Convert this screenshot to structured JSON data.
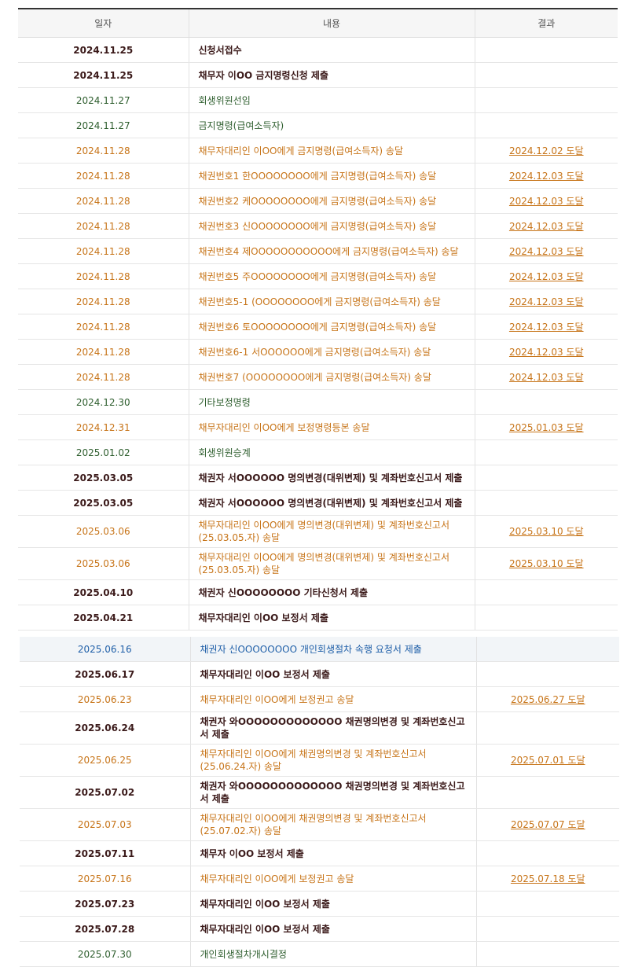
{
  "header": {
    "date": "일자",
    "content": "내용",
    "result": "결과"
  },
  "rows": [
    {
      "date": "2024.11.25",
      "content": "신청서접수",
      "result": "",
      "style": "dark"
    },
    {
      "date": "2024.11.25",
      "content": "채무자 이OO 금지명령신청 제출",
      "result": "",
      "style": "dark"
    },
    {
      "date": "2024.11.27",
      "content": "회생위원선임",
      "result": "",
      "style": "green"
    },
    {
      "date": "2024.11.27",
      "content": "금지명령(급여소득자)",
      "result": "",
      "style": "green"
    },
    {
      "date": "2024.11.28",
      "content": "채무자대리인 이OO에게 금지명령(급여소득자) 송달",
      "result": "2024.12.02 도달",
      "style": "orange"
    },
    {
      "date": "2024.11.28",
      "content": "채권번호1 한OOOOOOOO에게 금지명령(급여소득자) 송달",
      "result": "2024.12.03 도달",
      "style": "orange"
    },
    {
      "date": "2024.11.28",
      "content": "채권번호2 케OOOOOOOO에게 금지명령(급여소득자) 송달",
      "result": "2024.12.03 도달",
      "style": "orange"
    },
    {
      "date": "2024.11.28",
      "content": "채권번호3 신OOOOOOOO에게 금지명령(급여소득자) 송달",
      "result": "2024.12.03 도달",
      "style": "orange"
    },
    {
      "date": "2024.11.28",
      "content": "채권번호4 제OOOOOOOOOOO에게 금지명령(급여소득자) 송달",
      "result": "2024.12.03 도달",
      "style": "orange"
    },
    {
      "date": "2024.11.28",
      "content": "채권번호5 주OOOOOOOO에게 금지명령(급여소득자) 송달",
      "result": "2024.12.03 도달",
      "style": "orange"
    },
    {
      "date": "2024.11.28",
      "content": "채권번호5-1 (OOOOOOOO에게 금지명령(급여소득자) 송달",
      "result": "2024.12.03 도달",
      "style": "orange"
    },
    {
      "date": "2024.11.28",
      "content": "채권번호6 토OOOOOOOO에게 금지명령(급여소득자) 송달",
      "result": "2024.12.03 도달",
      "style": "orange"
    },
    {
      "date": "2024.11.28",
      "content": "채권번호6-1 서OOOOOO에게 금지명령(급여소득자) 송달",
      "result": "2024.12.03 도달",
      "style": "orange"
    },
    {
      "date": "2024.11.28",
      "content": "채권번호7 (OOOOOOOO에게 금지명령(급여소득자) 송달",
      "result": "2024.12.03 도달",
      "style": "orange"
    },
    {
      "date": "2024.12.30",
      "content": "기타보정명령",
      "result": "",
      "style": "green"
    },
    {
      "date": "2024.12.31",
      "content": "채무자대리인 이OO에게 보정명령등본 송달",
      "result": "2025.01.03 도달",
      "style": "orange"
    },
    {
      "date": "2025.01.02",
      "content": "회생위원승계",
      "result": "",
      "style": "green"
    },
    {
      "date": "2025.03.05",
      "content": "채권자 서OOOOOO 명의변경(대위변제) 및 계좌번호신고서 제출",
      "result": "",
      "style": "dark"
    },
    {
      "date": "2025.03.05",
      "content": "채권자 서OOOOOO 명의변경(대위변제) 및 계좌번호신고서 제출",
      "result": "",
      "style": "dark"
    },
    {
      "date": "2025.03.06",
      "content": "채무자대리인 이OO에게 명의변경(대위변제) 및 계좌번호신고서(25.03.05.자) 송달",
      "result": "2025.03.10 도달",
      "style": "orange",
      "tall": true
    },
    {
      "date": "2025.03.06",
      "content": "채무자대리인 이OO에게 명의변경(대위변제) 및 계좌번호신고서(25.03.05.자) 송달",
      "result": "2025.03.10 도달",
      "style": "orange",
      "tall": true
    },
    {
      "date": "2025.04.10",
      "content": "채권자 신OOOOOOOO 기타신청서 제출",
      "result": "",
      "style": "dark"
    },
    {
      "date": "2025.04.21",
      "content": "채무자대리인 이OO 보정서 제출",
      "result": "",
      "style": "dark"
    }
  ],
  "rows2": [
    {
      "date": "2025.06.16",
      "content": "채권자 신OOOOOOOO 개인회생절차 속행 요청서 제출",
      "result": "",
      "style": "hl"
    },
    {
      "date": "2025.06.17",
      "content": "채무자대리인 이OO 보정서 제출",
      "result": "",
      "style": "dark"
    },
    {
      "date": "2025.06.23",
      "content": "채무자대리인 이OO에게 보정권고 송달",
      "result": "2025.06.27 도달",
      "style": "orange"
    },
    {
      "date": "2025.06.24",
      "content": "채권자 와OOOOOOOOOOOOO 채권명의변경 및 계좌번호신고서 제출",
      "result": "",
      "style": "dark",
      "tall": true
    },
    {
      "date": "2025.06.25",
      "content": "채무자대리인 이OO에게 채권명의변경 및 계좌번호신고서(25.06.24.자) 송달",
      "result": "2025.07.01 도달",
      "style": "orange",
      "tall": true
    },
    {
      "date": "2025.07.02",
      "content": "채권자 와OOOOOOOOOOOOO 채권명의변경 및 계좌번호신고서 제출",
      "result": "",
      "style": "dark",
      "tall": true
    },
    {
      "date": "2025.07.03",
      "content": "채무자대리인 이OO에게 채권명의변경 및 계좌번호신고서(25.07.02.자) 송달",
      "result": "2025.07.07 도달",
      "style": "orange",
      "tall": true
    },
    {
      "date": "2025.07.11",
      "content": "채무자 이OO 보정서 제출",
      "result": "",
      "style": "dark"
    },
    {
      "date": "2025.07.16",
      "content": "채무자대리인 이OO에게 보정권고 송달",
      "result": "2025.07.18 도달",
      "style": "orange"
    },
    {
      "date": "2025.07.23",
      "content": "채무자대리인 이OO 보정서 제출",
      "result": "",
      "style": "dark"
    },
    {
      "date": "2025.07.28",
      "content": "채무자대리인 이OO 보정서 제출",
      "result": "",
      "style": "dark"
    },
    {
      "date": "2025.07.30",
      "content": "개인회생절차개시결정",
      "result": "",
      "style": "green"
    }
  ]
}
